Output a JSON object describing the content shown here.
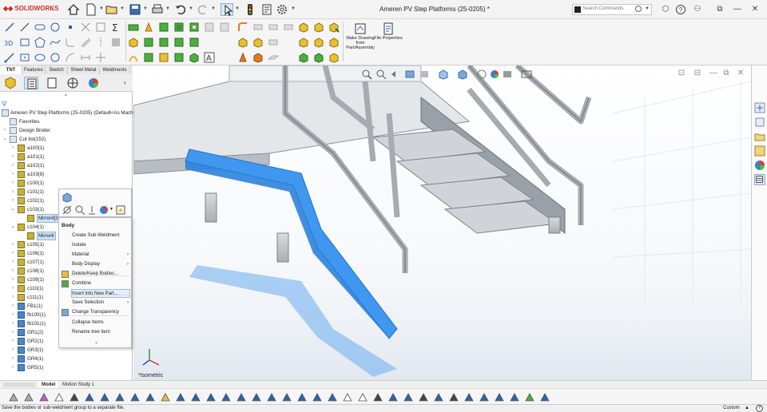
{
  "app": {
    "brand": "SOLIDWORKS",
    "document_title": "Ameren PV Step Platforms (25-0205) *"
  },
  "search": {
    "placeholder": "Search Commands"
  },
  "command_manager": {
    "make_drawing_label": "Make Drawing from Part/Assembly",
    "file_properties_label": "File Properties"
  },
  "tabs": [
    "TNT",
    "Features",
    "Sketch",
    "Sheet Metal",
    "Weldments"
  ],
  "tree": {
    "root": "Ameren PV Step Platforms (25-0205) (Default<As Machi",
    "items": [
      {
        "label": "Favorites",
        "indent": 1,
        "icon": "doc",
        "toggle": ""
      },
      {
        "label": "Design Binder",
        "indent": 1,
        "icon": "doc",
        "toggle": "›"
      },
      {
        "label": "Cut list(152)",
        "indent": 1,
        "icon": "doc",
        "toggle": "⌄"
      },
      {
        "label": "a100(1)",
        "indent": 2,
        "icon": "wld",
        "toggle": "›"
      },
      {
        "label": "a101(1)",
        "indent": 2,
        "icon": "wld",
        "toggle": "›"
      },
      {
        "label": "a102(1)",
        "indent": 2,
        "icon": "wld",
        "toggle": "›"
      },
      {
        "label": "a103(8)",
        "indent": 2,
        "icon": "wld",
        "toggle": "›"
      },
      {
        "label": "c100(1)",
        "indent": 2,
        "icon": "wld",
        "toggle": "›"
      },
      {
        "label": "c101(1)",
        "indent": 2,
        "icon": "wld",
        "toggle": "›"
      },
      {
        "label": "c102(1)",
        "indent": 2,
        "icon": "wld",
        "toggle": "›"
      },
      {
        "label": "c103(1)",
        "indent": 2,
        "icon": "wld",
        "toggle": "⌄"
      },
      {
        "label": "Mirror4[3]",
        "indent": 3,
        "icon": "wld",
        "toggle": "",
        "selected": true
      },
      {
        "label": "c104(1)",
        "indent": 2,
        "icon": "wld",
        "toggle": "⌄"
      },
      {
        "label": "Mirror6",
        "indent": 3,
        "icon": "wld",
        "toggle": "",
        "selected": true
      },
      {
        "label": "c105(1)",
        "indent": 2,
        "icon": "wld",
        "toggle": "›"
      },
      {
        "label": "c106(1)",
        "indent": 2,
        "icon": "wld",
        "toggle": "›"
      },
      {
        "label": "c107(1)",
        "indent": 2,
        "icon": "wld",
        "toggle": "›"
      },
      {
        "label": "c108(1)",
        "indent": 2,
        "icon": "wld",
        "toggle": "›"
      },
      {
        "label": "c109(1)",
        "indent": 2,
        "icon": "wld",
        "toggle": "›"
      },
      {
        "label": "c110(1)",
        "indent": 2,
        "icon": "wld",
        "toggle": "›"
      },
      {
        "label": "c111(1)",
        "indent": 2,
        "icon": "wld",
        "toggle": "›"
      },
      {
        "label": "FB1(1)",
        "indent": 2,
        "icon": "blue",
        "toggle": "›"
      },
      {
        "label": "fb100(1)",
        "indent": 2,
        "icon": "blue",
        "toggle": "›"
      },
      {
        "label": "fb101(1)",
        "indent": 2,
        "icon": "blue",
        "toggle": "›"
      },
      {
        "label": "GR1(2)",
        "indent": 2,
        "icon": "blue",
        "toggle": "›"
      },
      {
        "label": "GR2(1)",
        "indent": 2,
        "icon": "blue",
        "toggle": "›"
      },
      {
        "label": "GR3(1)",
        "indent": 2,
        "icon": "blue",
        "toggle": "›"
      },
      {
        "label": "GR4(1)",
        "indent": 2,
        "icon": "blue",
        "toggle": "›"
      },
      {
        "label": "GR5(1)",
        "indent": 2,
        "icon": "blue",
        "toggle": "›"
      }
    ]
  },
  "context_menu": {
    "title": "Body",
    "items": [
      {
        "label": "Create Sub-Weldment",
        "u": "C",
        "sub": false,
        "icon": ""
      },
      {
        "label": "Isolate",
        "u": "I",
        "sub": false,
        "icon": ""
      },
      {
        "label": "Material",
        "u": "M",
        "sub": true,
        "icon": ""
      },
      {
        "label": "Body Display",
        "u": "B",
        "sub": true,
        "icon": ""
      },
      {
        "label": "Delete/Keep Bodies...",
        "u": "D",
        "sub": false,
        "icon": "delete-keep-bodies-icon"
      },
      {
        "label": "Combine",
        "u": "C",
        "sub": false,
        "icon": "combine-icon"
      },
      {
        "label": "Insert into New Part...",
        "u": "I",
        "sub": false,
        "icon": "",
        "highlight": true
      },
      {
        "label": "Save Selection",
        "u": "S",
        "sub": true,
        "icon": ""
      },
      {
        "label": "Change Transparency",
        "u": "",
        "sub": false,
        "icon": "change-transparency-icon"
      },
      {
        "label": "Collapse Items",
        "u": "",
        "sub": false,
        "icon": ""
      },
      {
        "label": "Rename tree item",
        "u": "R",
        "sub": false,
        "icon": ""
      }
    ],
    "more": "⌄"
  },
  "viewport": {
    "view_label": "*Isometric"
  },
  "bottom_tabs": [
    "Model",
    "Motion Study 1"
  ],
  "status": {
    "text": "Save the bodies or sub-weldment group to a separate file.",
    "units": "Custom",
    "dropdown": "▲"
  },
  "colors": {
    "selection_blue": "#3f97f0",
    "steel": "#c9cdd2",
    "accent": "#1f6fc5"
  }
}
